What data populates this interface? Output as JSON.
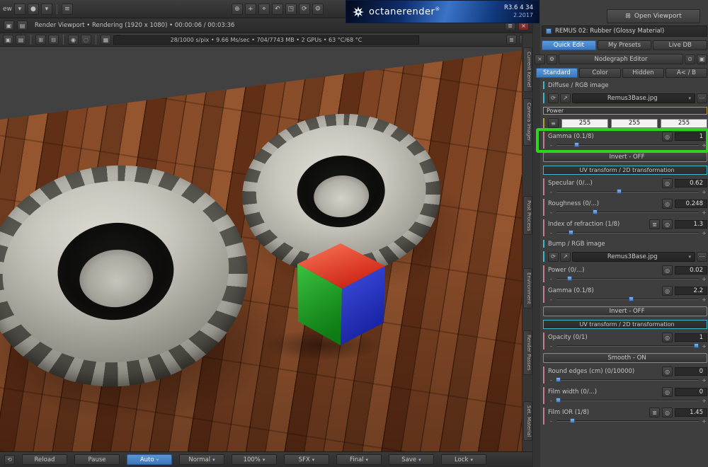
{
  "ui": {
    "minus": "-",
    "plus": "+"
  },
  "colors": {
    "accent_blue": "#3d7ec7",
    "tab_blue": "#4a8fd2",
    "handle_blue": "#5f93d6",
    "annotation_green": "#2fd41f"
  },
  "icons": {
    "dropdown": "▾",
    "close": "×",
    "help": "?",
    "gear": "⚙",
    "refresh": "⟳",
    "reload": "⟲",
    "open_file": "↗",
    "dots": "⋯",
    "list": "≣",
    "menu": "≡",
    "rows": "≡",
    "knob": "◎",
    "dot": "●",
    "save": "▣",
    "image": "▤",
    "grid": "⊞",
    "grid2": "⊟",
    "focus": "◉",
    "region": "◌",
    "picture": "▦",
    "pin": "⊙",
    "target": "⌖",
    "move": "+",
    "orbit": "↶",
    "frame": "◳",
    "zoom": "⊕",
    "viewport": "⊞"
  },
  "top_bar": {
    "left_label": "ew",
    "open_viewport_label": "Open Viewport",
    "banner": {
      "brand": "octanerender",
      "reg": "®",
      "version": "R3.6 4 34",
      "build": "2.2017"
    }
  },
  "viewport": {
    "title": "Render Viewport  •  Rendering (1920 x 1080)  •  00:00:06 / 00:03:36",
    "stats": "28/1000 s/pix  •  9.66 Ms/sec  •  704/7743 MB  •  2 GPUs  •  63 °C/68 °C",
    "side_tabs": [
      "Current Kernel",
      "Camera Imager",
      "Post Process",
      "Environment",
      "Render Passes",
      "Set. Material"
    ],
    "bottom_buttons": [
      {
        "label": "Reload"
      },
      {
        "label": "Pause"
      },
      {
        "label": "Auto"
      },
      {
        "label": "Normal"
      },
      {
        "label": "100%"
      },
      {
        "label": "SFX"
      },
      {
        "label": "Final"
      },
      {
        "label": "Save"
      },
      {
        "label": "Lock"
      }
    ]
  },
  "material_panel": {
    "header": "REMUS 02: Rubber (Glossy Material)",
    "tabs": [
      "Quick Edit",
      "My Presets",
      "Live DB"
    ],
    "nodegraph_button": "Nodegraph Editor",
    "filter_tabs": [
      "Standard",
      "Color",
      "Hidden",
      "A< / B"
    ],
    "params": {
      "diffuse_section": "Diffuse / RGB image",
      "diffuse_file": "Remus3Base.jpg",
      "power_label": "Power",
      "power_rgb": [
        "255",
        "255",
        "255"
      ],
      "diffuse_gamma_label": "Gamma (0.1/8)",
      "diffuse_gamma_value": "1",
      "invert_label": "Invert - OFF",
      "uv_label": "UV transform / 2D transformation",
      "specular_label": "Specular (0/...)",
      "specular_value": "0.62",
      "roughness_label": "Roughness (0/...)",
      "roughness_value": "0.248",
      "ior_label": "Index of refraction (1/8)",
      "ior_value": "1.3",
      "bump_section": "Bump / RGB image",
      "bump_file": "Remus3Base.jpg",
      "bump_power_label": "Power (0/...)",
      "bump_power_value": "0.02",
      "bump_gamma_label": "Gamma (0.1/8)",
      "bump_gamma_value": "2.2",
      "invert2_label": "Invert - OFF",
      "uv2_label": "UV transform / 2D transformation",
      "opacity_label": "Opacity (0/1)",
      "opacity_value": "1",
      "smooth_label": "Smooth - ON",
      "round_label": "Round edges (cm) (0/10000)",
      "round_value": "0",
      "film_width_label": "Film width (0/...)",
      "film_width_value": "0",
      "film_ior_label": "Film IOR (1/8)",
      "film_ior_value": "1.45"
    }
  }
}
